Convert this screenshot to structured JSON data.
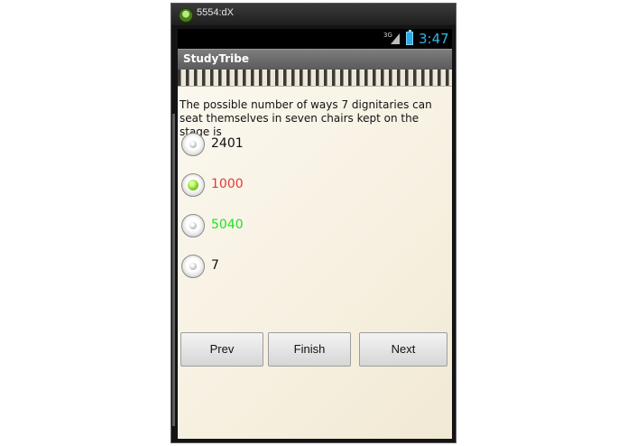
{
  "window": {
    "title": "5554:dX"
  },
  "status_bar": {
    "network": "3G",
    "time": "3:47"
  },
  "app": {
    "title": "StudyTribe"
  },
  "question": {
    "text": "The possible number of ways 7 dignitaries can seat themselves in seven chairs kept on the stage is",
    "options": [
      {
        "label": "2401",
        "color": "#111111",
        "selected": false
      },
      {
        "label": "1000",
        "color": "#e53935",
        "selected": true
      },
      {
        "label": "5040",
        "color": "#22e022",
        "selected": false
      },
      {
        "label": "7",
        "color": "#111111",
        "selected": false
      }
    ]
  },
  "buttons": {
    "prev": "Prev",
    "finish": "Finish",
    "next": "Next"
  }
}
